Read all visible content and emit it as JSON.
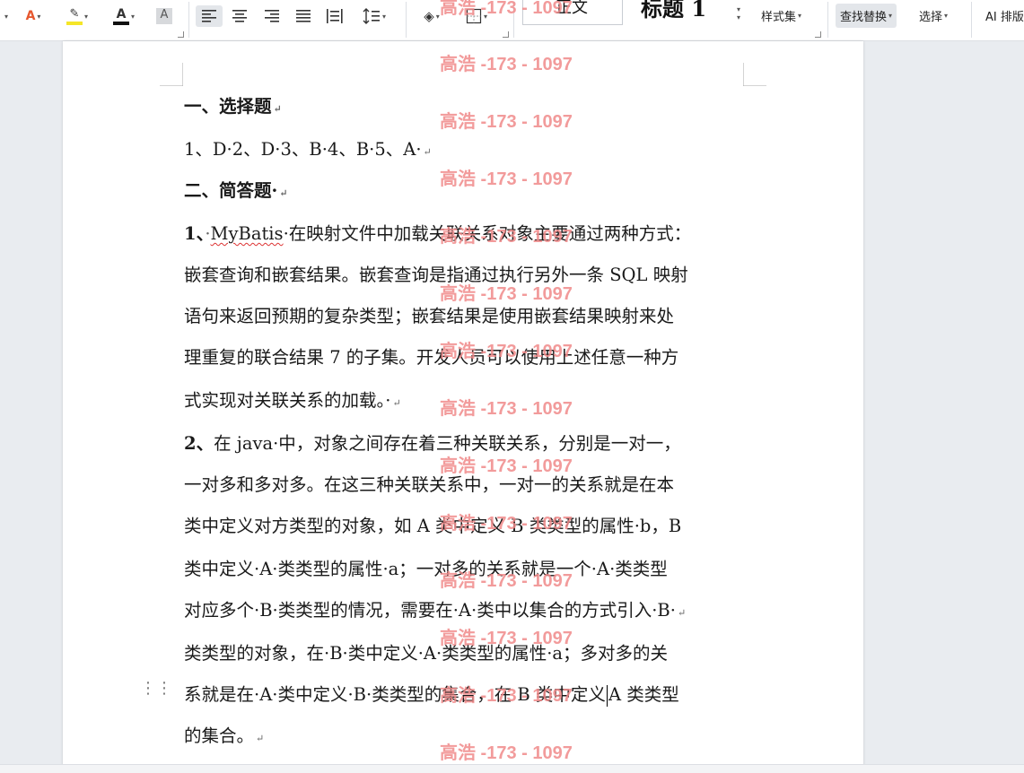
{
  "toolbar": {
    "letter_a": "A",
    "style_preview_1": "正文",
    "style_preview_2": "标题 1",
    "style_set": "样式集",
    "find_replace": "查找替换",
    "select": "选择",
    "ai_layout": "AI 排版"
  },
  "document": {
    "lines": [
      "一、选择题",
      "1、D·2、D·3、B·4、B·5、A·",
      "二、简答题·",
      "1、",
      "MyBatis",
      "·在映射文件中加载关联关系对象主要通过两种方式：",
      "嵌套查询和嵌套结果。嵌套查询是指通过执行另外一条 SQL 映射",
      "语句来返回预期的复杂类型；嵌套结果是使用嵌套结果映射来处",
      "理重复的联合结果 7 的子集。开发人员可以使用上述任意一种方",
      "式实现对关联关系的加载。·",
      "2、",
      "在 java·中，对象之间存在着三种关联关系，分别是一对一，",
      "一对多和多对多。在这三种关联关系中，一对一的关系就是在本",
      "类中定义对方类型的对象，如 A 类中定义 B 类类型的属性·b，B",
      "类中定义·A·类类型的属性·a；一对多的关系就是一个·A·类类型",
      "对应多个·B·类类型的情况，需要在·A·类中以集合的方式引入·B·",
      "类类型的对象，在·B·类中定义·A·类类型的属性·a；多对多的关",
      "系就是在·A·类中定义·B·类类型的集合，在 B 类中定义",
      "A 类类型",
      "的集合。"
    ],
    "para_mark": "↵"
  },
  "watermark": {
    "text": "高浩 -173 - 1097",
    "color": "#f08a8a"
  }
}
